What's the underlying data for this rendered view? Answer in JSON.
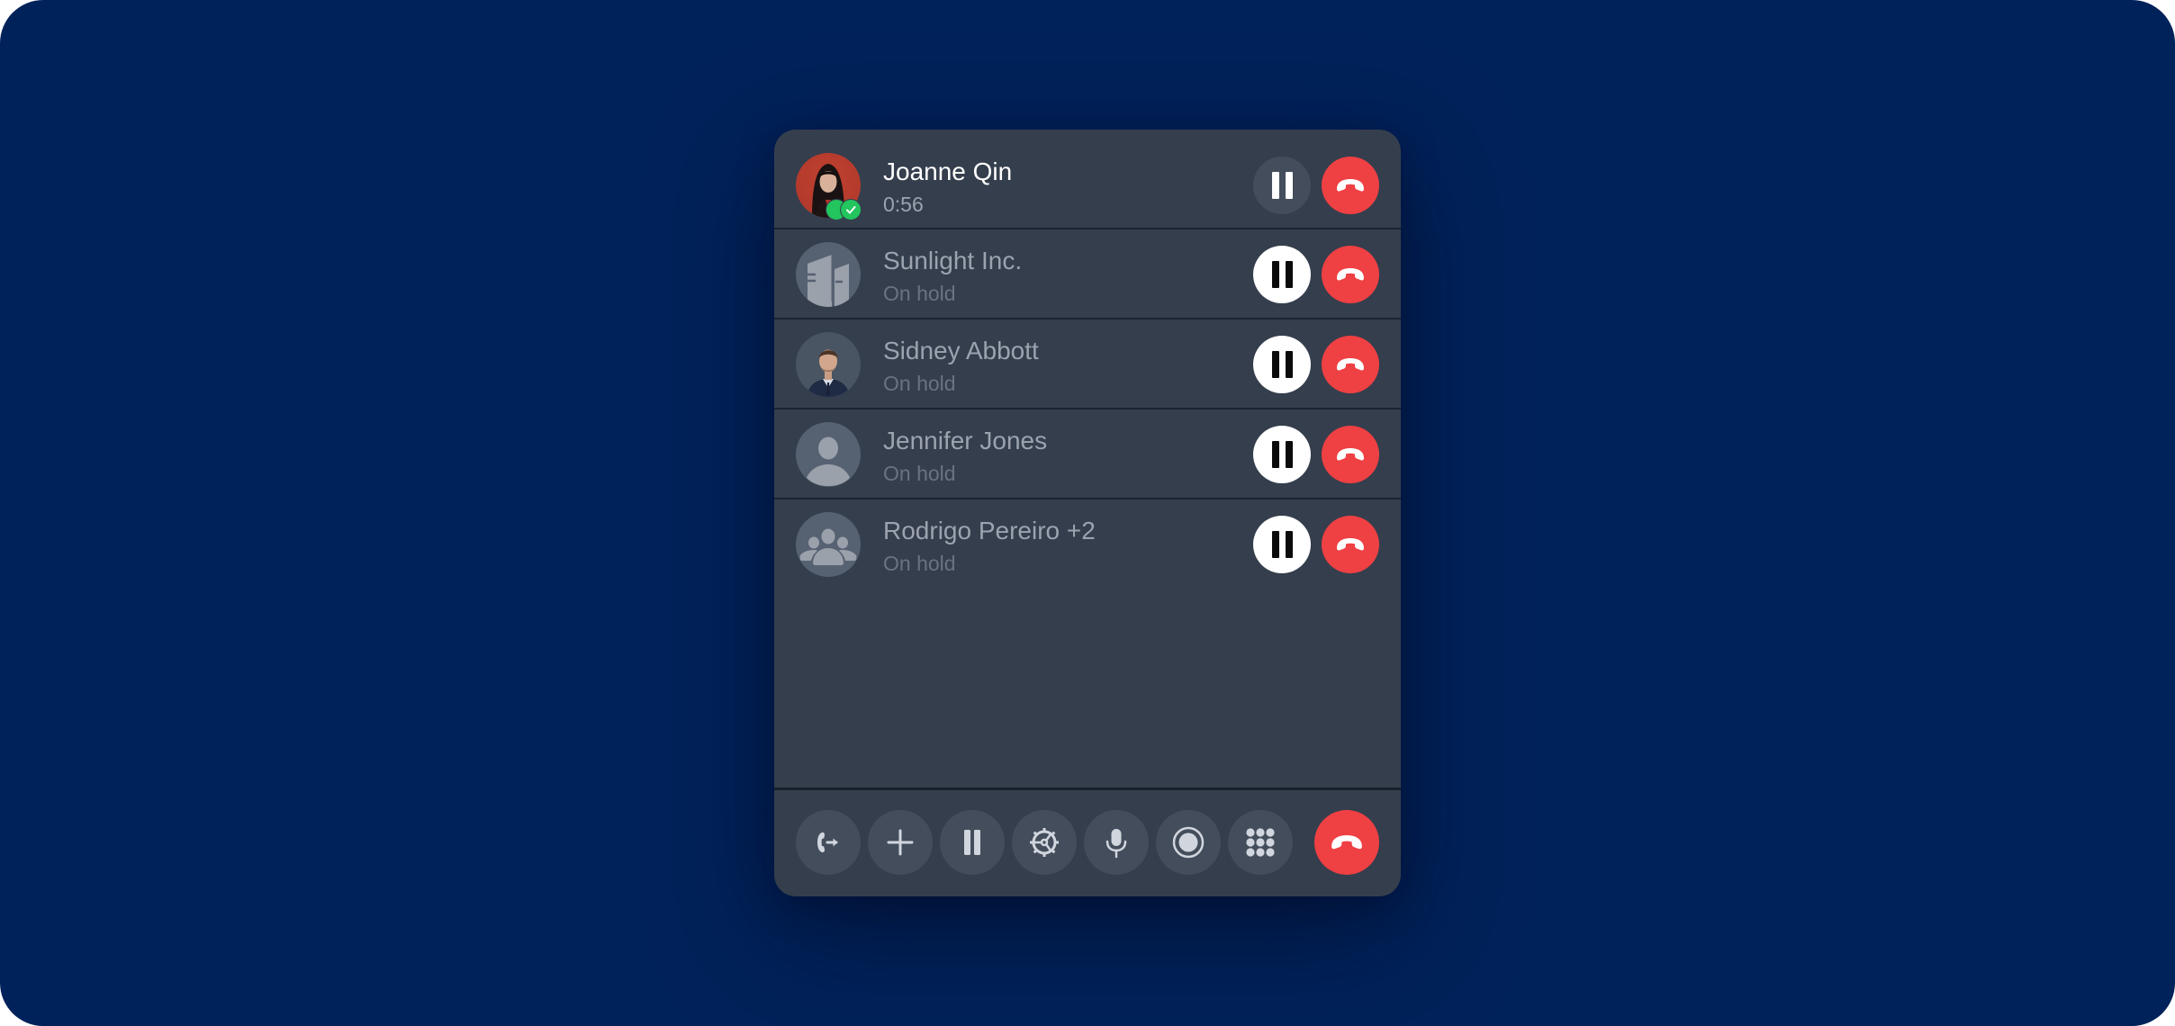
{
  "colors": {
    "background": "#00225a",
    "card": "#353e4d",
    "end_call": "#ef4043",
    "active_badge": "#22c55e"
  },
  "calls": [
    {
      "name": "Joanne Qin",
      "status": "0:56",
      "state": "active",
      "avatar": "photo-woman",
      "badge": "connected-check-icon",
      "pause_label": "Hold",
      "end_label": "End call"
    },
    {
      "name": "Sunlight Inc.",
      "status": "On hold",
      "state": "held",
      "avatar": "building-icon",
      "pause_label": "Resume",
      "end_label": "End call"
    },
    {
      "name": "Sidney Abbott",
      "status": "On hold",
      "state": "held",
      "avatar": "photo-man",
      "pause_label": "Resume",
      "end_label": "End call"
    },
    {
      "name": "Jennifer Jones",
      "status": "On hold",
      "state": "held",
      "avatar": "person-icon",
      "pause_label": "Resume",
      "end_label": "End call"
    },
    {
      "name": "Rodrigo Pereiro +2",
      "status": "On hold",
      "state": "held",
      "avatar": "group-icon",
      "pause_label": "Resume",
      "end_label": "End call"
    }
  ],
  "toolbar": [
    {
      "icon": "transfer-call-icon",
      "label": "Transfer"
    },
    {
      "icon": "plus-icon",
      "label": "Add call"
    },
    {
      "icon": "pause-icon",
      "label": "Hold"
    },
    {
      "icon": "merge-icon",
      "label": "Merge"
    },
    {
      "icon": "microphone-icon",
      "label": "Mute"
    },
    {
      "icon": "record-icon",
      "label": "Record"
    },
    {
      "icon": "keypad-icon",
      "label": "Keypad"
    },
    {
      "icon": "end-call-icon",
      "label": "End all calls"
    }
  ]
}
